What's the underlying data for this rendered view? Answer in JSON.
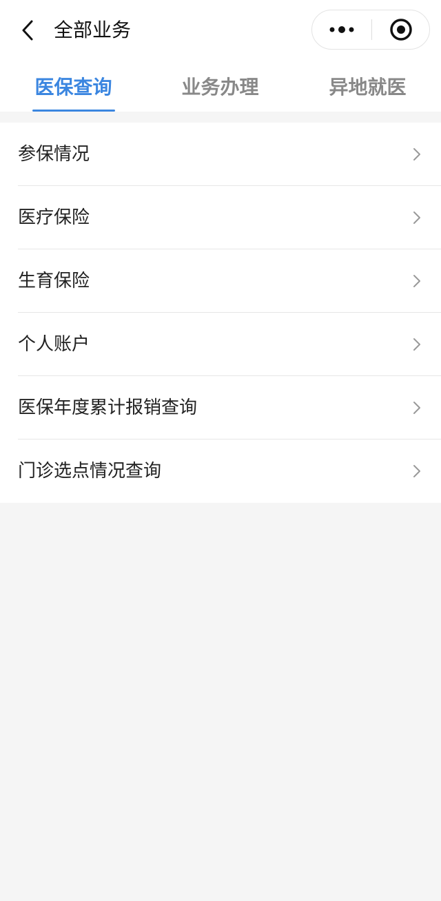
{
  "header": {
    "title": "全部业务",
    "back_icon": "chevron-left-icon",
    "more_icon": "more-dots-icon",
    "close_icon": "target-close-icon"
  },
  "tabs": [
    {
      "label": "医保查询",
      "active": true
    },
    {
      "label": "业务办理",
      "active": false
    },
    {
      "label": "异地就医",
      "active": false
    }
  ],
  "list": {
    "items": [
      {
        "label": "参保情况"
      },
      {
        "label": "医疗保险"
      },
      {
        "label": "生育保险"
      },
      {
        "label": "个人账户"
      },
      {
        "label": "医保年度累计报销查询"
      },
      {
        "label": "门诊选点情况查询"
      }
    ]
  },
  "colors": {
    "accent": "#3b86e0",
    "tab_inactive": "#888888",
    "background": "#f5f5f5"
  }
}
